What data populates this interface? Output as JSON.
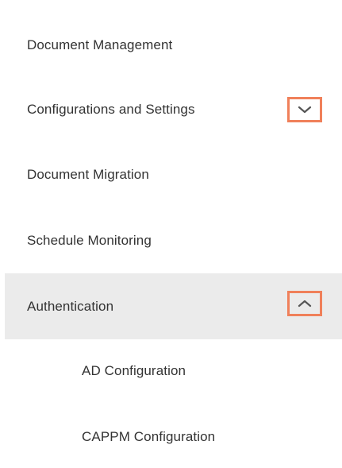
{
  "menu": {
    "items": [
      {
        "label": "Document Management"
      },
      {
        "label": "Configurations and Settings"
      },
      {
        "label": "Document Migration"
      },
      {
        "label": "Schedule Monitoring"
      },
      {
        "label": "Authentication"
      }
    ],
    "sub_items": [
      {
        "label": "AD Configuration"
      },
      {
        "label": "CAPPM Configuration"
      }
    ]
  },
  "icons": {
    "collapsed_chevron": "chevron-down-icon",
    "expanded_chevron": "chevron-up-icon"
  },
  "colors": {
    "text": "#333333",
    "active_background": "#ebebeb",
    "highlight_border": "#f0805a",
    "chevron": "#555555"
  }
}
